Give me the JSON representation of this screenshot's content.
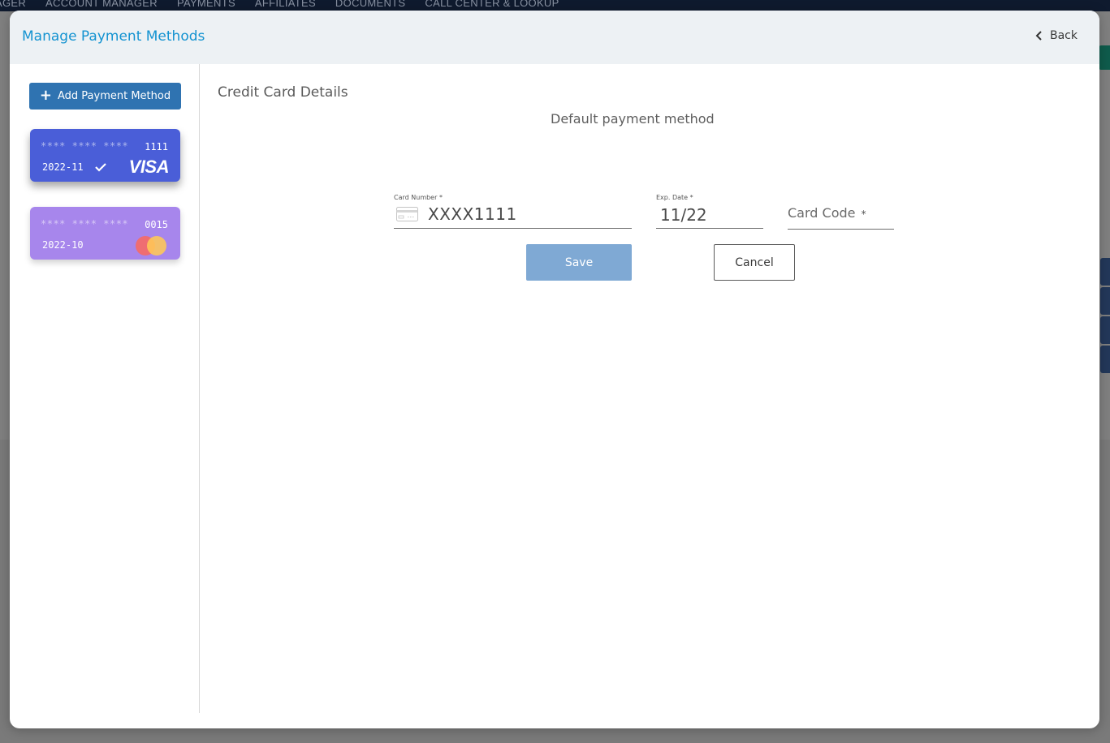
{
  "background_nav": {
    "items": [
      "AGER",
      "ACCOUNT MANAGER",
      "PAYMENTS",
      "AFFILIATES",
      "DOCUMENTS",
      "CALL CENTER & LOOKUP"
    ]
  },
  "modal": {
    "title": "Manage Payment Methods",
    "back_label": "Back"
  },
  "sidebar": {
    "add_button_label": "Add Payment Method",
    "add_button_icon": "plus-icon",
    "cards": [
      {
        "mask": "**** **** ****",
        "last4": "1111",
        "expiry": "2022-11",
        "brand": "VISA",
        "is_default": true,
        "color": "#4a5ed8"
      },
      {
        "mask": "**** **** ****",
        "last4": "0015",
        "expiry": "2022-10",
        "brand": "mastercard",
        "is_default": false,
        "color": "#a786ec"
      }
    ]
  },
  "details": {
    "section_title": "Credit Card Details",
    "default_label": "Default payment method",
    "card_number": {
      "label": "Card Number",
      "required_mark": "*",
      "value": "XXXX1111",
      "icon": "credit-card-icon"
    },
    "exp_date": {
      "label": "Exp. Date",
      "required_mark": "*",
      "value": "11/22"
    },
    "card_code": {
      "placeholder": "Card Code",
      "required_mark": "*",
      "value": ""
    },
    "save_label": "Save",
    "cancel_label": "Cancel"
  },
  "colors": {
    "accent": "#1493d1",
    "primary_button": "#2f73b1",
    "save_button_disabled": "#7fa9d4"
  }
}
